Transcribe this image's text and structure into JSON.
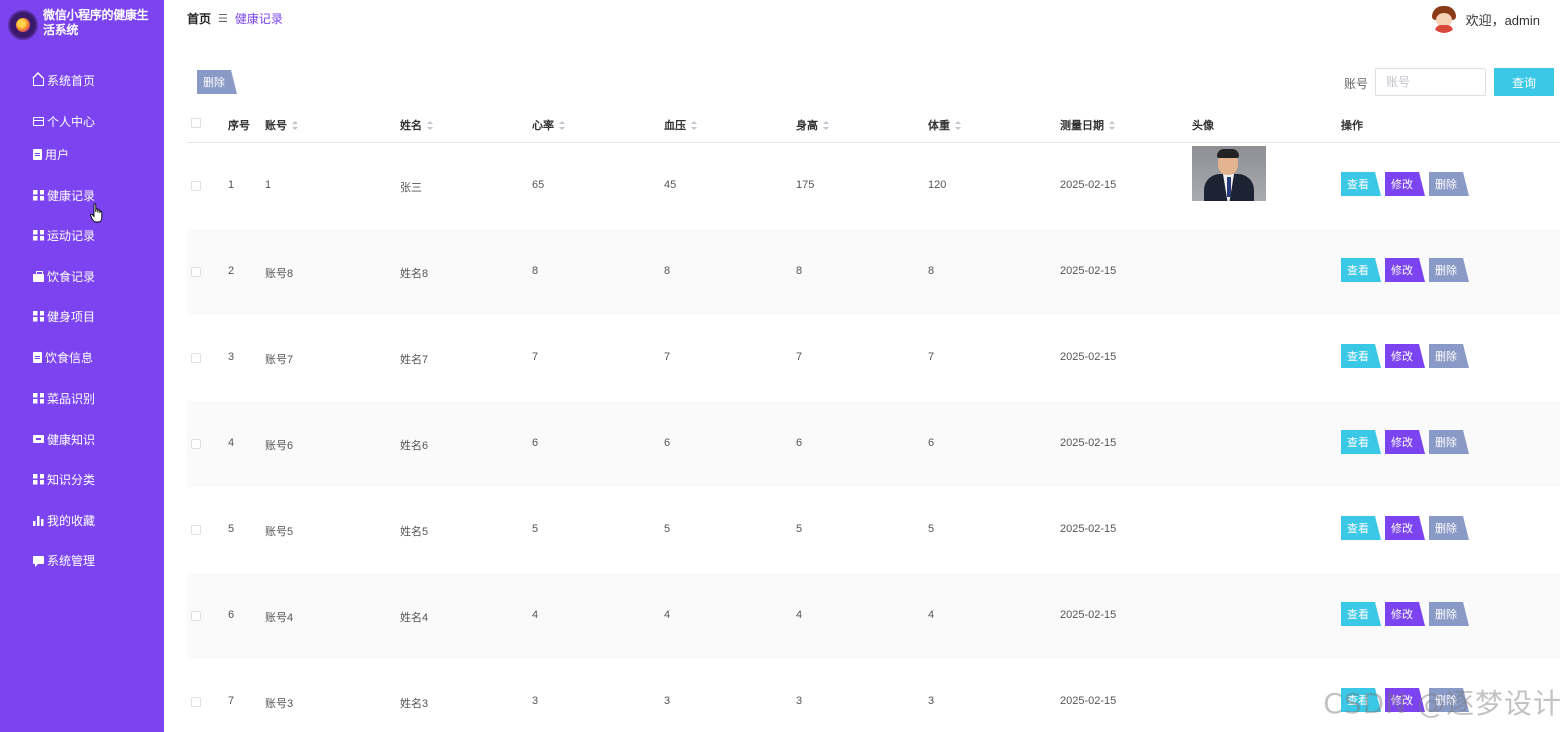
{
  "app": {
    "title": "微信小程序的健康生活系统"
  },
  "sidebar": {
    "items": [
      {
        "label": "系统首页",
        "icon": "home-icon"
      },
      {
        "label": "个人中心",
        "icon": "id-card-icon"
      },
      {
        "label": "用户",
        "icon": "clipboard-icon"
      },
      {
        "label": "健康记录",
        "icon": "grid-icon"
      },
      {
        "label": "运动记录",
        "icon": "grid-icon"
      },
      {
        "label": "饮食记录",
        "icon": "briefcase-icon"
      },
      {
        "label": "健身项目",
        "icon": "grid-icon"
      },
      {
        "label": "饮食信息",
        "icon": "clipboard-icon"
      },
      {
        "label": "菜品识别",
        "icon": "grid-icon"
      },
      {
        "label": "健康知识",
        "icon": "ticket-icon"
      },
      {
        "label": "知识分类",
        "icon": "grid-icon"
      },
      {
        "label": "我的收藏",
        "icon": "bar-chart-icon"
      },
      {
        "label": "系统管理",
        "icon": "chat-icon"
      }
    ]
  },
  "header": {
    "breadcrumb": {
      "home": "首页",
      "separator": "☰",
      "current": "健康记录"
    },
    "welcome": "欢迎，admin"
  },
  "toolbar": {
    "delete_label": "删除",
    "search_label": "账号",
    "search_placeholder": "账号",
    "search_value": "",
    "query_label": "查询"
  },
  "table": {
    "columns": [
      "序号",
      "账号",
      "姓名",
      "心率",
      "血压",
      "身高",
      "体重",
      "测量日期",
      "头像",
      "操作"
    ],
    "actions": {
      "view": "查看",
      "edit": "修改",
      "delete": "删除"
    },
    "rows": [
      {
        "index": "1",
        "account": "1",
        "name": "张三",
        "heart_rate": "65",
        "blood_pressure": "45",
        "height": "175",
        "weight": "120",
        "date": "2025-02-15",
        "has_avatar": true
      },
      {
        "index": "2",
        "account": "账号8",
        "name": "姓名8",
        "heart_rate": "8",
        "blood_pressure": "8",
        "height": "8",
        "weight": "8",
        "date": "2025-02-15",
        "has_avatar": false
      },
      {
        "index": "3",
        "account": "账号7",
        "name": "姓名7",
        "heart_rate": "7",
        "blood_pressure": "7",
        "height": "7",
        "weight": "7",
        "date": "2025-02-15",
        "has_avatar": false
      },
      {
        "index": "4",
        "account": "账号6",
        "name": "姓名6",
        "heart_rate": "6",
        "blood_pressure": "6",
        "height": "6",
        "weight": "6",
        "date": "2025-02-15",
        "has_avatar": false
      },
      {
        "index": "5",
        "account": "账号5",
        "name": "姓名5",
        "heart_rate": "5",
        "blood_pressure": "5",
        "height": "5",
        "weight": "5",
        "date": "2025-02-15",
        "has_avatar": false
      },
      {
        "index": "6",
        "account": "账号4",
        "name": "姓名4",
        "heart_rate": "4",
        "blood_pressure": "4",
        "height": "4",
        "weight": "4",
        "date": "2025-02-15",
        "has_avatar": false
      },
      {
        "index": "7",
        "account": "账号3",
        "name": "姓名3",
        "heart_rate": "3",
        "blood_pressure": "3",
        "height": "3",
        "weight": "3",
        "date": "2025-02-15",
        "has_avatar": false
      }
    ]
  },
  "watermark": "CSDN @逐梦设计",
  "colors": {
    "sidebar": "#7b44f0",
    "view_button": "#3bc8e6",
    "edit_button": "#7b44f0",
    "delete_button": "#8a9ac6"
  }
}
